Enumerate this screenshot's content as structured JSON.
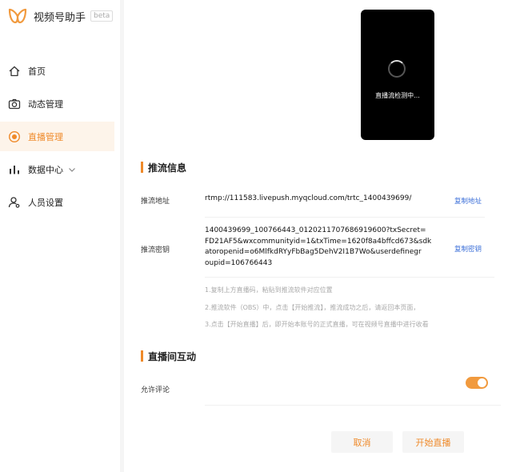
{
  "sidebar": {
    "brand_name": "视频号助手",
    "brand_badge": "beta",
    "items": [
      {
        "label": "首页",
        "icon": "home-icon"
      },
      {
        "label": "动态管理",
        "icon": "camera-icon"
      },
      {
        "label": "直播管理",
        "icon": "live-icon",
        "active": true
      },
      {
        "label": "数据中心",
        "icon": "bar-chart-icon",
        "expandable": true
      },
      {
        "label": "人员设置",
        "icon": "user-settings-icon"
      }
    ]
  },
  "preview": {
    "status_text": "直播流检测中..."
  },
  "push_info": {
    "section_title": "推流信息",
    "address_label": "推流地址",
    "address_value": "rtmp://111583.livepush.myqcloud.com/trtc_1400439699/",
    "copy_address_label": "复制地址",
    "key_label": "推流密钥",
    "key_lines": [
      "1400439699_100766443_0120211707686919600?txSecret=",
      "FD21AF5&wxcommunityid=1&txTime=1620f8a4bffcd673&sdk",
      "atoropenid=o6MlfkdRYyFbBag5DehV2I1B7Wo&userdefinegr",
      "oupid=106766443"
    ],
    "copy_key_label": "复制密钥",
    "hints": [
      "1.复制上方直播码，粘贴到推流软件对应位置",
      "2.推流软件（OBS）中，点击【开始推流】，推流成功之后，请返回本页面，",
      "3.点击【开始直播】后，即开始本账号的正式直播，可在视频号直播中进行收看"
    ]
  },
  "interaction": {
    "section_title": "直播间互动",
    "allow_comment_label": "允许评论",
    "allow_comment_on": true
  },
  "actions": {
    "cancel_label": "取消",
    "start_label": "开始直播"
  },
  "colors": {
    "accent": "#ef8a2a",
    "active_bg": "#fdf4ea",
    "link": "#3a6ed8",
    "toggle": "#f19a3e"
  }
}
